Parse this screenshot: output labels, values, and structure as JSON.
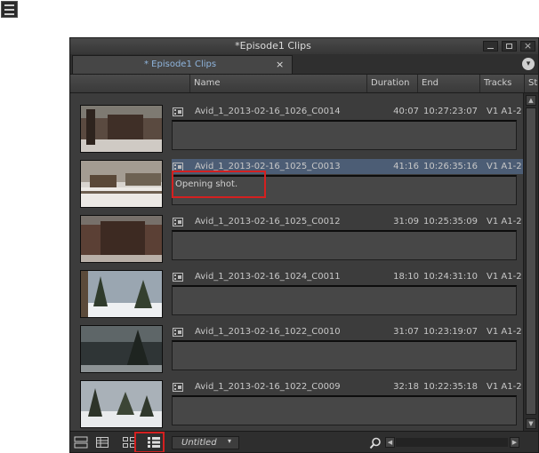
{
  "window": {
    "title": "*Episode1 Clips",
    "tab_label": "* Episode1 Clips",
    "tab_close": "×",
    "tab_menu": "▾",
    "controls": {
      "close": "×"
    }
  },
  "columns": [
    "Name",
    "Duration",
    "End",
    "Tracks",
    "St"
  ],
  "clips": [
    {
      "name": "Avid_1_2013-02-16_1026_C0014",
      "duration": "40:07",
      "end": "10:27:23:07",
      "tracks": "V1 A1-2",
      "comment": ""
    },
    {
      "name": "Avid_1_2013-02-16_1025_C0013",
      "duration": "41:16",
      "end": "10:26:35:16",
      "tracks": "V1 A1-2",
      "comment": "Opening shot."
    },
    {
      "name": "Avid_1_2013-02-16_1025_C0012",
      "duration": "31:09",
      "end": "10:25:35:09",
      "tracks": "V1 A1-2",
      "comment": ""
    },
    {
      "name": "Avid_1_2013-02-16_1024_C0011",
      "duration": "18:10",
      "end": "10:24:31:10",
      "tracks": "V1 A1-2",
      "comment": ""
    },
    {
      "name": "Avid_1_2013-02-16_1022_C0010",
      "duration": "31:07",
      "end": "10:23:19:07",
      "tracks": "V1 A1-2",
      "comment": ""
    },
    {
      "name": "Avid_1_2013-02-16_1022_C0009",
      "duration": "32:18",
      "end": "10:22:35:18",
      "tracks": "V1 A1-2",
      "comment": ""
    }
  ],
  "footer": {
    "view_name": "Untitled",
    "view_arrow": "▾"
  },
  "scroll": {
    "up": "▲",
    "down": "▼",
    "left": "◀",
    "right": "▶"
  },
  "colors": {
    "highlight": "#d42020",
    "selection": "#4c5d75",
    "tab_text": "#8fb5de"
  },
  "icons": [
    "bin-list-icon",
    "clip-icon",
    "search-icon",
    "frame-view-icon",
    "text-view-icon",
    "script-view-icon",
    "frame-detail-view-icon"
  ]
}
